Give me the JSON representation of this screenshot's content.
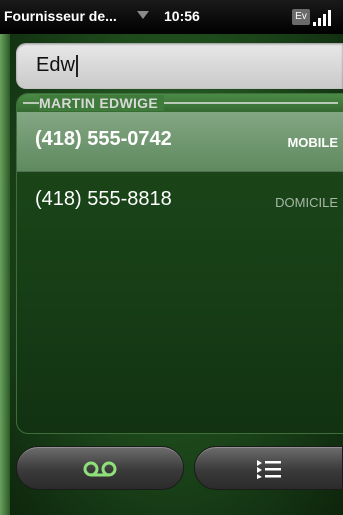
{
  "status_bar": {
    "carrier": "Fournisseur de...",
    "time": "10:56",
    "network_badge": "Ev",
    "icons": [
      "carrier-dropdown-caret-icon",
      "signal-strength-icon"
    ]
  },
  "search": {
    "value": "Edw"
  },
  "contact": {
    "name": "MARTIN EDWIGE",
    "numbers": [
      {
        "number": "(418) 555-0742",
        "type": "MOBILE",
        "selected": true
      },
      {
        "number": "(418) 555-8818",
        "type": "DOMICILE",
        "selected": false
      }
    ]
  },
  "bottom_bar": {
    "icons": [
      "voicemail-icon",
      "call-list-icon"
    ]
  },
  "colors": {
    "screen_green": "#1f4d1d",
    "selected_row": "#6f986f",
    "header_green": "#3f7b3b"
  }
}
